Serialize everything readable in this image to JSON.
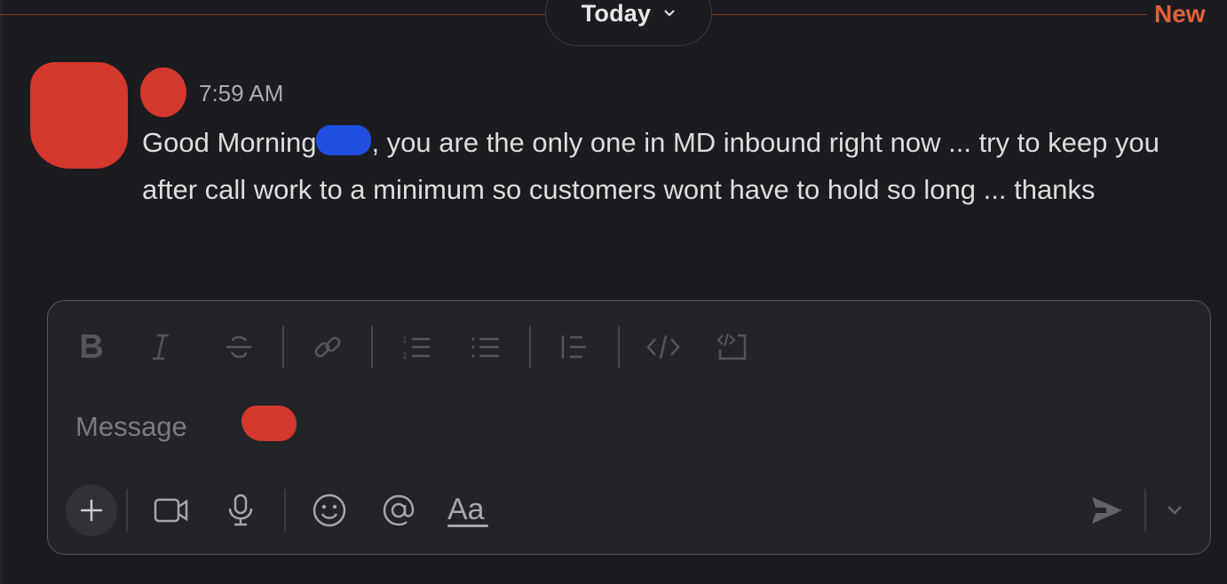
{
  "divider": {
    "day_label": "Today",
    "new_label": "New",
    "new_color": "#e0623c"
  },
  "message": {
    "avatar": "redacted",
    "author": "redacted",
    "timestamp": "7:59 AM",
    "text_before_mention": "Good Morning",
    "mention": "redacted",
    "text_after_mention": ", you are the only one in MD inbound right now ... try to keep you after call work to a minimum so customers wont have to hold so long ... thanks"
  },
  "composer": {
    "placeholder": "Message",
    "value": "",
    "format_toolbar": [
      {
        "name": "bold",
        "icon": "bold-icon"
      },
      {
        "name": "italic",
        "icon": "italic-icon"
      },
      {
        "name": "strikethrough",
        "icon": "strikethrough-icon"
      },
      {
        "name": "link",
        "icon": "link-icon"
      },
      {
        "name": "ordered-list",
        "icon": "ordered-list-icon"
      },
      {
        "name": "bulleted-list",
        "icon": "bulleted-list-icon"
      },
      {
        "name": "blockquote",
        "icon": "blockquote-icon"
      },
      {
        "name": "code",
        "icon": "code-icon"
      },
      {
        "name": "code-block",
        "icon": "code-block-icon"
      }
    ],
    "bold_glyph": "B",
    "actions": [
      {
        "name": "attach",
        "icon": "plus-icon"
      },
      {
        "name": "video-clip",
        "icon": "video-icon"
      },
      {
        "name": "audio-clip",
        "icon": "microphone-icon"
      },
      {
        "name": "emoji",
        "icon": "emoji-icon"
      },
      {
        "name": "mention",
        "icon": "at-icon"
      },
      {
        "name": "formatting",
        "icon": "text-format-icon",
        "label": "Aa"
      }
    ],
    "send_icon": "send-icon",
    "send_options_icon": "chevron-down-icon"
  }
}
